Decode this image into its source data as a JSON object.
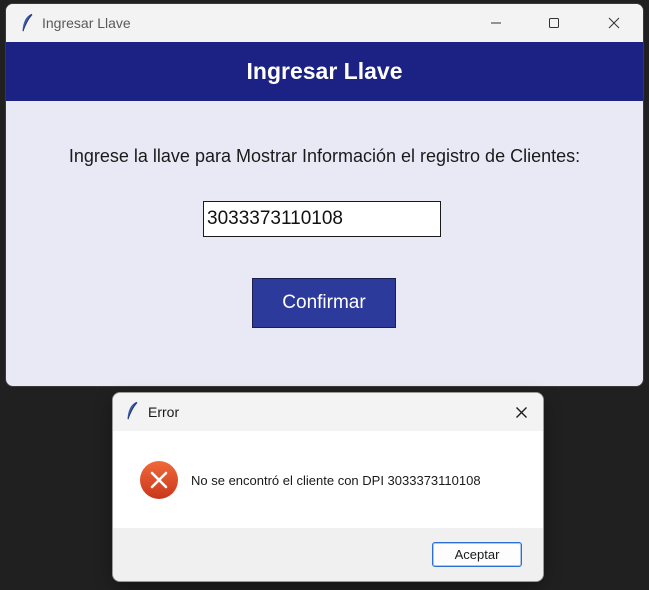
{
  "main_window": {
    "title": "Ingresar Llave",
    "header": "Ingresar Llave",
    "prompt": "Ingrese la llave para Mostrar Información el registro de Clientes:",
    "key_input_value": "3033373110108",
    "confirm_label": "Confirmar",
    "icons": {
      "app": "feather-icon",
      "minimize": "minimize-icon",
      "maximize": "maximize-icon",
      "close": "close-icon"
    }
  },
  "error_dialog": {
    "title": "Error",
    "message": "No se encontró el cliente con DPI 3033373110108",
    "accept_label": "Aceptar",
    "icons": {
      "app": "feather-icon",
      "close": "close-icon",
      "status": "error-icon"
    }
  },
  "colors": {
    "header_bg": "#1b2283",
    "window_bg": "#e9e9f5",
    "button_bg": "#2c3a9c",
    "error_red": "#e0472a",
    "focus_blue": "#2b6fd4"
  }
}
